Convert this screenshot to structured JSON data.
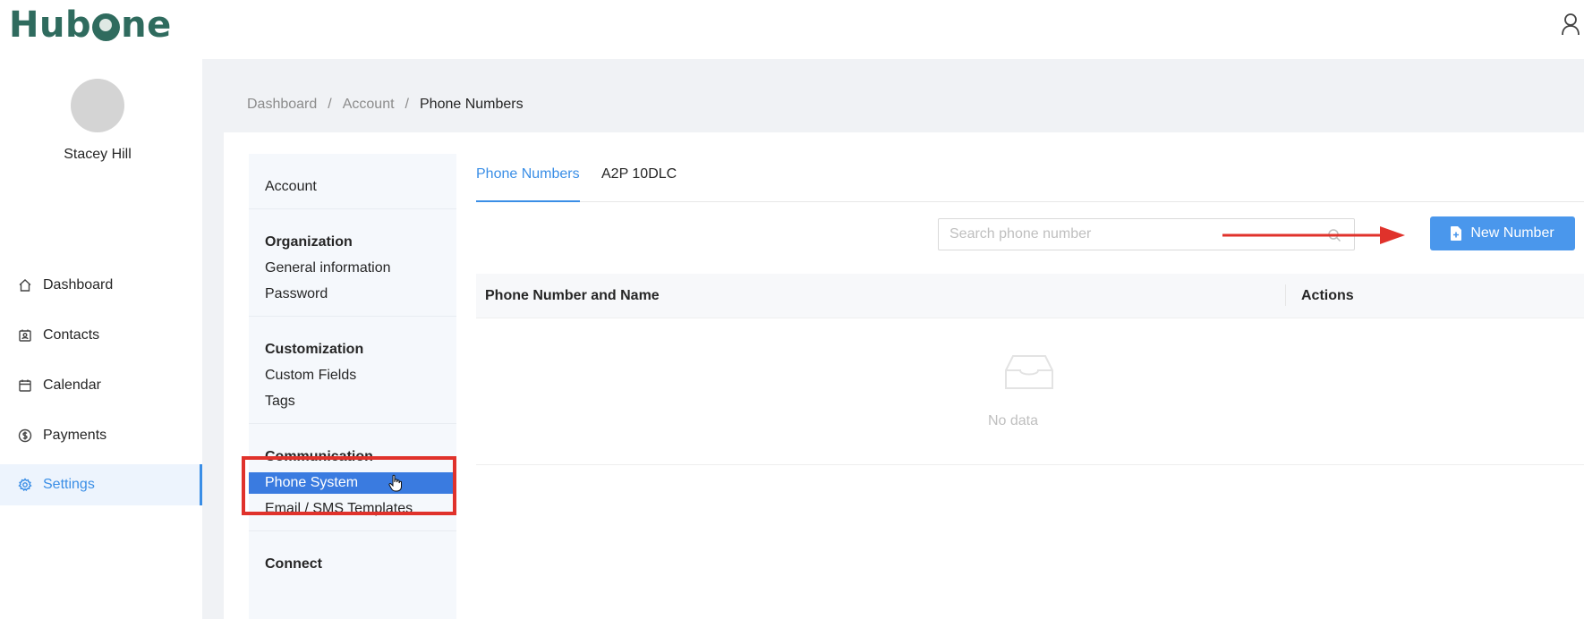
{
  "brand": {
    "name_part1": "Hub",
    "name_part2": "ne"
  },
  "user": {
    "name": "Stacey Hill"
  },
  "nav": {
    "items": [
      {
        "label": "Dashboard",
        "icon": "home-icon"
      },
      {
        "label": "Contacts",
        "icon": "contacts-icon"
      },
      {
        "label": "Calendar",
        "icon": "calendar-icon"
      },
      {
        "label": "Payments",
        "icon": "dollar-icon"
      },
      {
        "label": "Settings",
        "icon": "gear-icon",
        "active": true
      }
    ]
  },
  "breadcrumb": {
    "items": [
      "Dashboard",
      "Account"
    ],
    "separator": "/",
    "current": "Phone Numbers"
  },
  "submenu": {
    "account": "Account",
    "organization": {
      "heading": "Organization",
      "items": [
        "General information",
        "Password"
      ]
    },
    "customization": {
      "heading": "Customization",
      "items": [
        "Custom Fields",
        "Tags"
      ]
    },
    "communication": {
      "heading": "Communication",
      "active": "Phone System",
      "items": [
        "Email / SMS Templates"
      ]
    },
    "connect": {
      "heading": "Connect"
    }
  },
  "tabs": [
    {
      "label": "Phone Numbers",
      "active": true
    },
    {
      "label": "A2P 10DLC"
    }
  ],
  "search": {
    "placeholder": "Search phone number"
  },
  "new_button": {
    "label": "New Number"
  },
  "table": {
    "columns": [
      "Phone Number and Name",
      "Actions"
    ],
    "empty_text": "No data"
  },
  "colors": {
    "accent": "#3a8ee6",
    "brand": "#2f6b5e",
    "annotation_red": "#e0322b"
  }
}
